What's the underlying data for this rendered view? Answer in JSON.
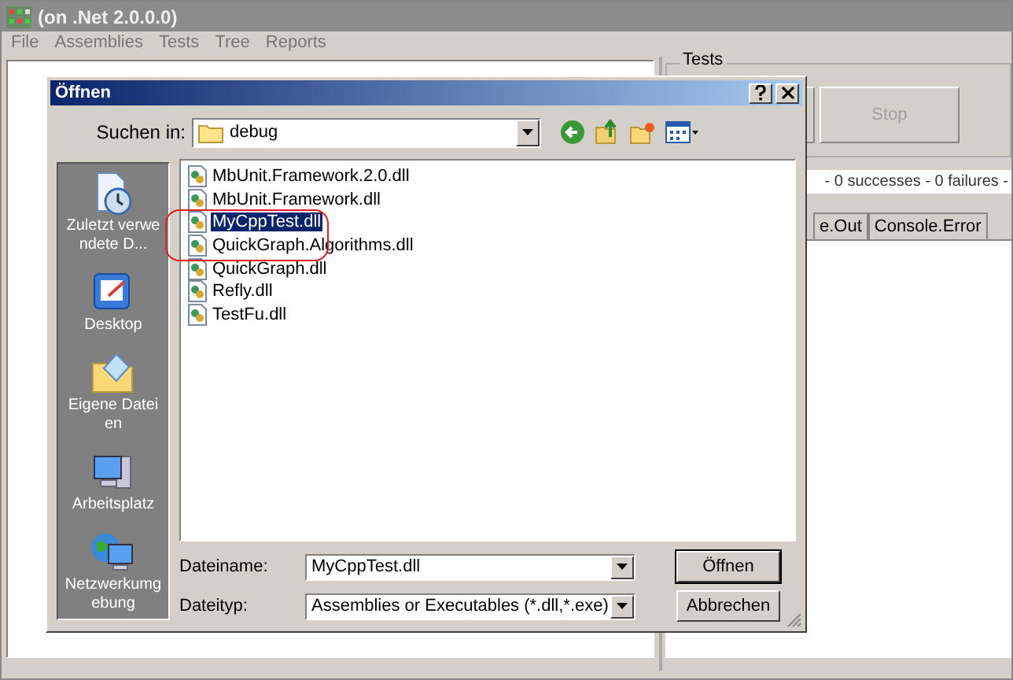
{
  "main_window": {
    "title": "(on .Net 2.0.0.0)",
    "menu": [
      "File",
      "Assemblies",
      "Tests",
      "Tree",
      "Reports"
    ],
    "tests_group": "Tests",
    "stop_button": {
      "label": "Stop",
      "disabled": true
    },
    "status": "- 0 successes - 0 failures -",
    "tabs": [
      "e.Out",
      "Console.Error"
    ]
  },
  "dialog": {
    "title": "Öffnen",
    "look_in_label": "Suchen in:",
    "look_in_value": "debug",
    "places": [
      {
        "kind": "recent",
        "label": "Zuletzt verwendete D..."
      },
      {
        "kind": "desktop",
        "label": "Desktop"
      },
      {
        "kind": "documents",
        "label": "Eigene Dateien"
      },
      {
        "kind": "computer",
        "label": "Arbeitsplatz"
      },
      {
        "kind": "network",
        "label": "Netzwerkumgebung"
      }
    ],
    "files": [
      {
        "name": "MbUnit.Framework.2.0.dll",
        "selected": false
      },
      {
        "name": "MbUnit.Framework.dll",
        "selected": false
      },
      {
        "name": "MyCppTest.dll",
        "selected": true
      },
      {
        "name": "QuickGraph.Algorithms.dll",
        "selected": false
      },
      {
        "name": "QuickGraph.dll",
        "selected": false
      },
      {
        "name": "Refly.dll",
        "selected": false
      },
      {
        "name": "TestFu.dll",
        "selected": false
      }
    ],
    "filename_label": "Dateiname:",
    "filename": "MyCppTest.dll",
    "filetype_label": "Dateityp:",
    "filetype": "Assemblies or Executables (*.dll,*.exe)",
    "buttons": [
      "Öffnen",
      "Abbrechen"
    ]
  }
}
